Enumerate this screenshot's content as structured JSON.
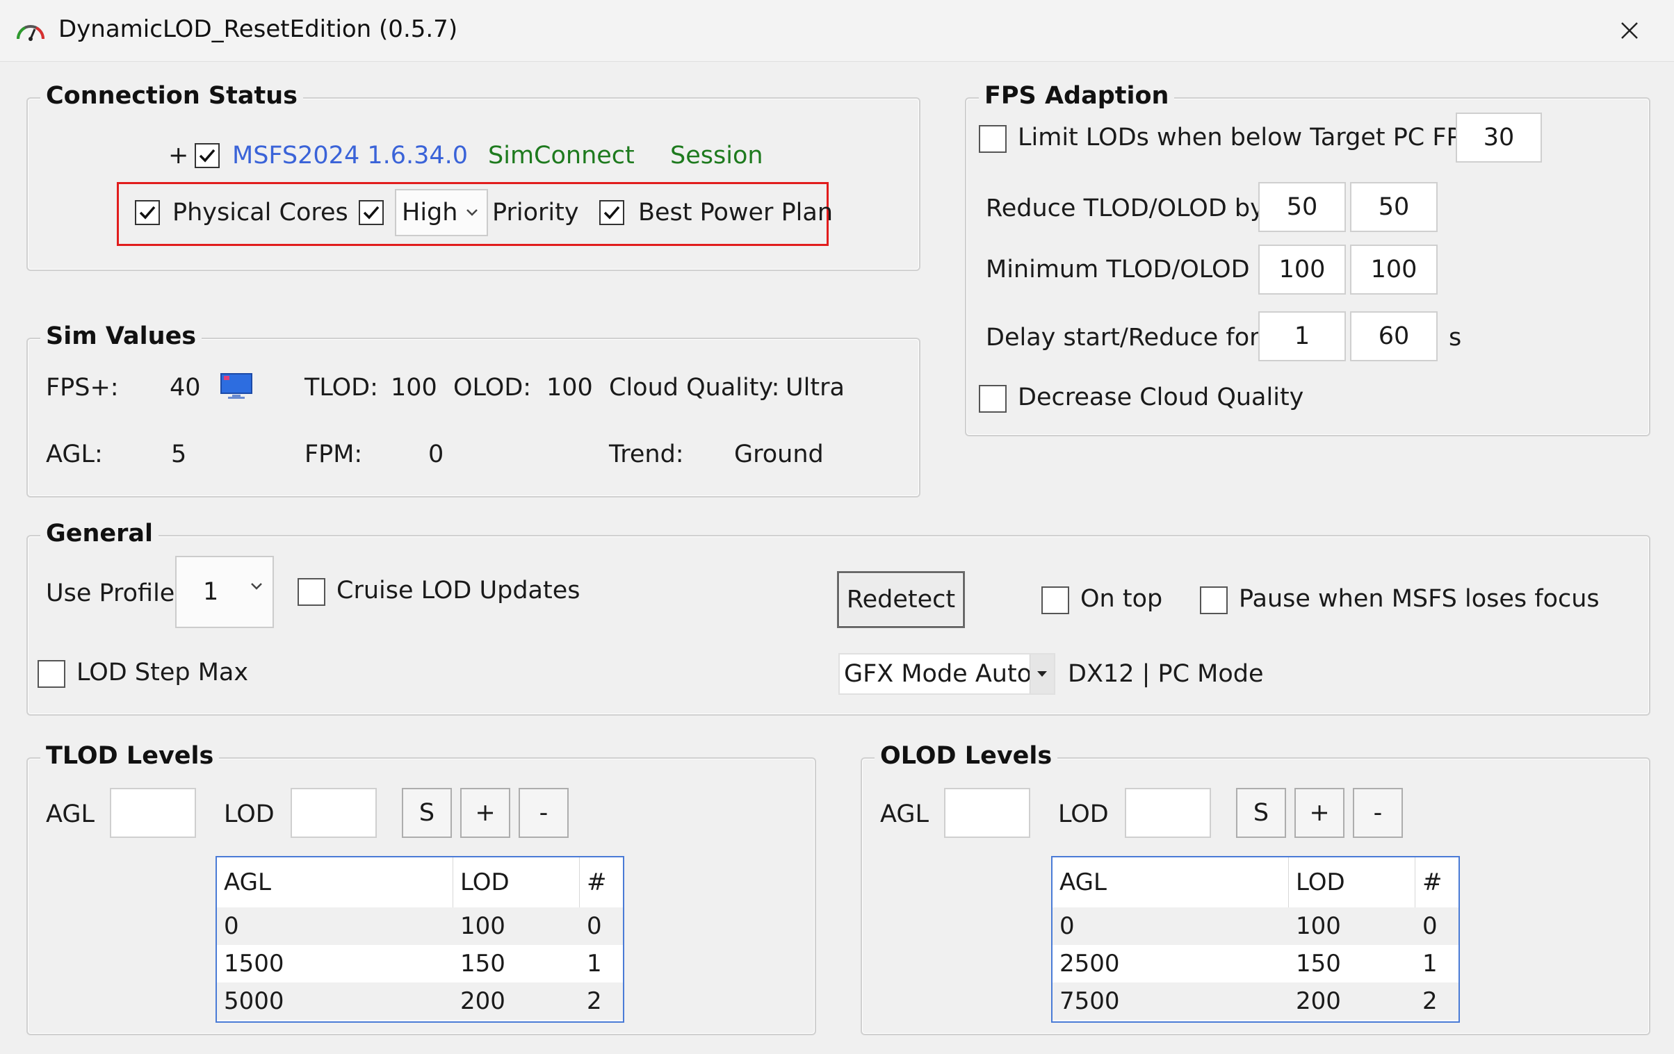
{
  "window": {
    "title": "DynamicLOD_ResetEdition (0.5.7)"
  },
  "connection": {
    "title": "Connection Status",
    "plus": "+",
    "msfs_label": "MSFS2024 1.6.34.0",
    "simconnect": "SimConnect",
    "session": "Session",
    "physical_cores": "Physical Cores",
    "priority_value": "High",
    "priority_label": "Priority",
    "best_power_plan": "Best Power Plan",
    "colors": {
      "ok": "#1e7a1e",
      "link": "#3a63d8",
      "highlight": "#e11d1d"
    }
  },
  "sim_values": {
    "title": "Sim Values",
    "fps_label": "FPS+:",
    "fps_value": "40",
    "tlod_label": "TLOD:",
    "tlod_value": "100",
    "olod_label": "OLOD:",
    "olod_value": "100",
    "cloud_label": "Cloud Quality:",
    "cloud_value": "Ultra",
    "agl_label": "AGL:",
    "agl_value": "5",
    "fpm_label": "FPM:",
    "fpm_value": "0",
    "trend_label": "Trend:",
    "trend_value": "Ground"
  },
  "fps_adaption": {
    "title": "FPS Adaption",
    "limit_label": "Limit LODs when below Target PC FPS:",
    "target_fps": "30",
    "reduce_label": "Reduce TLOD/OLOD by",
    "reduce_tlod": "50",
    "reduce_olod": "50",
    "min_label": "Minimum TLOD/OLOD",
    "min_tlod": "100",
    "min_olod": "100",
    "delay_label": "Delay start/Reduce for",
    "delay_start": "1",
    "reduce_for": "60",
    "seconds_unit": "s",
    "decrease_cloud": "Decrease Cloud Quality"
  },
  "general": {
    "title": "General",
    "use_profile_label": "Use Profile",
    "profile_value": "1",
    "cruise_lod": "Cruise LOD Updates",
    "redetect_button": "Redetect",
    "on_top": "On top",
    "pause_focus": "Pause when MSFS loses focus",
    "lod_step_max": "LOD Step Max",
    "gfx_mode": "GFX Mode Auto",
    "dx_mode": "DX12 | PC Mode"
  },
  "tlod_levels": {
    "title": "TLOD Levels",
    "agl_label": "AGL",
    "lod_label": "LOD",
    "s_button": "S",
    "plus_button": "+",
    "minus_button": "-",
    "headers": [
      "AGL",
      "LOD",
      "#"
    ],
    "rows": [
      [
        "0",
        "100",
        "0"
      ],
      [
        "1500",
        "150",
        "1"
      ],
      [
        "5000",
        "200",
        "2"
      ]
    ]
  },
  "olod_levels": {
    "title": "OLOD Levels",
    "agl_label": "AGL",
    "lod_label": "LOD",
    "s_button": "S",
    "plus_button": "+",
    "minus_button": "-",
    "headers": [
      "AGL",
      "LOD",
      "#"
    ],
    "rows": [
      [
        "0",
        "100",
        "0"
      ],
      [
        "2500",
        "150",
        "1"
      ],
      [
        "7500",
        "200",
        "2"
      ]
    ]
  }
}
